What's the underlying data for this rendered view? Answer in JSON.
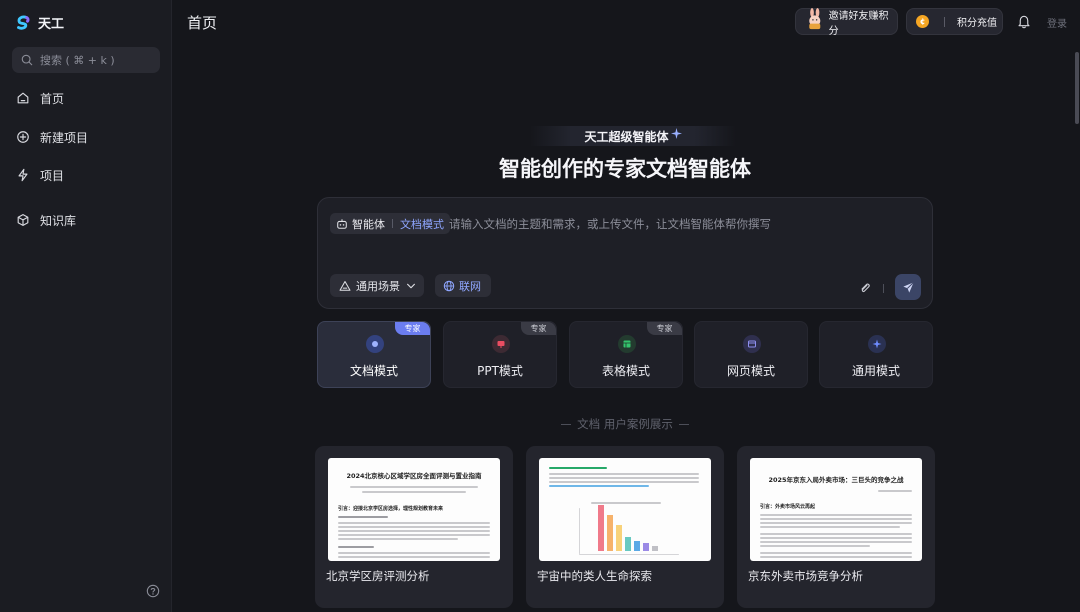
{
  "app": {
    "name": "天工",
    "page_title": "首页",
    "login_label": "登录"
  },
  "sidebar": {
    "search_placeholder": "搜索 ( ⌘ + k )",
    "items": [
      {
        "label": "首页",
        "icon": "home-icon"
      },
      {
        "label": "新建项目",
        "icon": "plus-circle-icon"
      },
      {
        "label": "项目",
        "icon": "lightning-icon"
      },
      {
        "label": "知识库",
        "icon": "cube-icon"
      }
    ]
  },
  "header": {
    "invite_label": "邀请好友赚积分",
    "points_label": "积分充值"
  },
  "hero": {
    "badge": "天工超级智能体",
    "title": "智能创作的专家文档智能体"
  },
  "composer": {
    "agent_label": "智能体",
    "mode_label": "文档模式",
    "placeholder": "请输入文档的主题和需求，或上传文件，让文档智能体帮你撰写",
    "scene_label": "通用场景",
    "web_label": "联网"
  },
  "modes": [
    {
      "label": "文档模式",
      "tag": "专家",
      "active": true,
      "color": "#3b4f9e"
    },
    {
      "label": "PPT模式",
      "tag": "专家",
      "active": false,
      "color": "#c23a4a"
    },
    {
      "label": "表格模式",
      "tag": "专家",
      "active": false,
      "color": "#2aa85a"
    },
    {
      "label": "网页模式",
      "tag": "",
      "active": false,
      "color": "#5b5fd1"
    },
    {
      "label": "通用模式",
      "tag": "",
      "active": false,
      "color": "#3d57c9"
    }
  ],
  "cases": {
    "heading": "文档 用户案例展示",
    "items": [
      {
        "title": "北京学区房评测分析",
        "doc_heading": "2024北京核心区域学区房全面评测与置业指南",
        "doc_sub": "引言：迎接北京学区房选择，理性规划教育未来"
      },
      {
        "title": "宇宙中的类人生命探索",
        "doc_heading": "",
        "doc_sub": ""
      },
      {
        "title": "京东外卖市场竞争分析",
        "doc_heading": "2025年京东入局外卖市场：三巨头的竞争之战",
        "doc_sub": "引言：外卖市场风云再起"
      }
    ]
  }
}
